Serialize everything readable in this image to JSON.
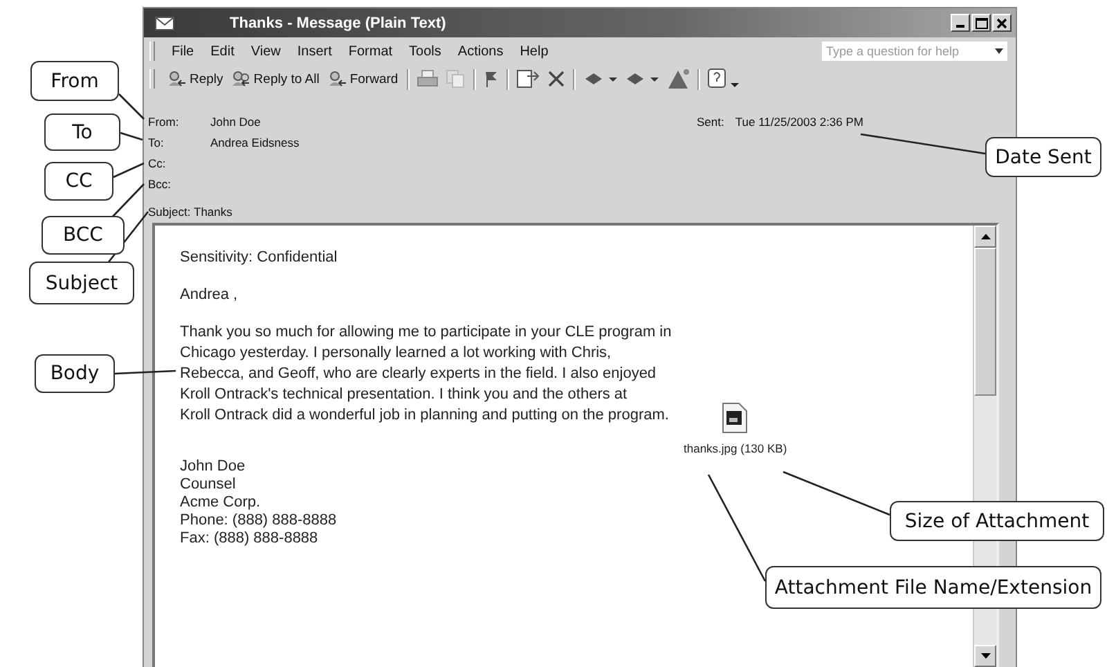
{
  "window": {
    "title": "Thanks - Message (Plain Text)"
  },
  "menu": [
    "File",
    "Edit",
    "View",
    "Insert",
    "Format",
    "Tools",
    "Actions",
    "Help"
  ],
  "help_search": {
    "placeholder": "Type a question for help"
  },
  "toolbar": [
    {
      "kind": "reply",
      "label": "Reply"
    },
    {
      "kind": "reply_all",
      "label": "Reply to All"
    },
    {
      "kind": "forward",
      "label": "Forward"
    },
    {
      "kind": "print"
    },
    {
      "kind": "copy"
    },
    {
      "kind": "flag"
    },
    {
      "kind": "move"
    },
    {
      "kind": "delete"
    },
    {
      "kind": "previous"
    },
    {
      "kind": "next"
    },
    {
      "kind": "address_book"
    },
    {
      "kind": "help"
    }
  ],
  "header": [
    {
      "label": "From:",
      "value": "John Doe"
    },
    {
      "label": "To:",
      "value": "Andrea Eidsness"
    },
    {
      "label": "Cc:"
    },
    {
      "label": "Bcc:"
    },
    {
      "label": "Subject:",
      "value": "Thanks"
    }
  ],
  "sent": {
    "label": "Sent:",
    "value": "Tue 11/25/2003 2:36 PM"
  },
  "body": {
    "sensitivity": "Sensitivity: Confidential",
    "greeting": "Andrea ,",
    "paragraph": [
      "Thank you so much for allowing me to participate in your CLE program in",
      "Chicago yesterday. I personally learned a lot working with Chris,",
      "Rebecca, and Geoff, who are clearly experts in the field. I also enjoyed",
      "Kroll Ontrack's technical presentation. I think you and the others at",
      "Kroll Ontrack did a wonderful job in planning and putting on the program."
    ],
    "signature": [
      "John Doe",
      "Counsel",
      "Acme Corp.",
      "Phone: (888) 888-8888",
      "Fax: (888) 888-8888"
    ]
  },
  "attachment": {
    "name": "thanks.jpg (130 KB)"
  },
  "callouts": [
    "From",
    "To",
    "CC",
    "BCC",
    "Subject",
    "Body",
    "Date Sent",
    "Size of Attachment",
    "Attachment File Name/Extension"
  ]
}
